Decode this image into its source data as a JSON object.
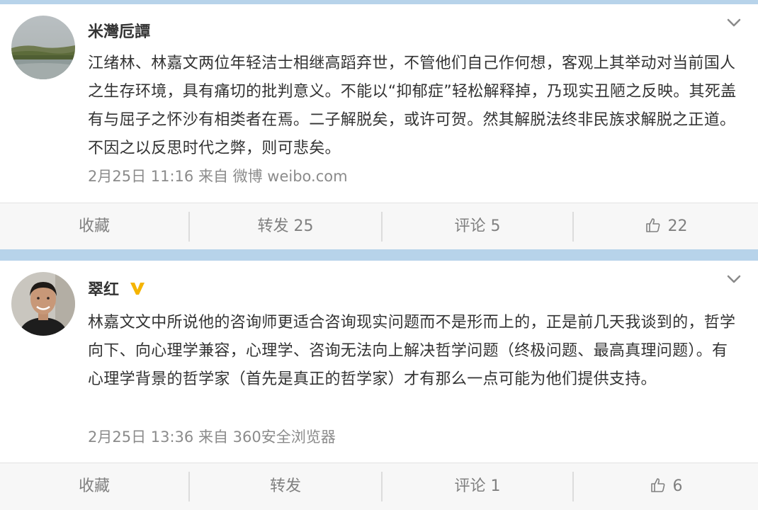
{
  "posts": [
    {
      "username": "米灣卮譚",
      "content": "江绪林、林嘉文两位年轻洁士相继高蹈弃世，不管他们自己作何想，客观上其举动对当前国人之生存环境，具有痛切的批判意义。不能以“抑郁症”轻松解释掉，乃现实丑陋之反映。其死盖有与屈子之怀沙有相类者在焉。二子解脱矣，或许可贺。然其解脱法终非民族求解脱之正道。不因之以反思时代之弊，则可悲矣。",
      "meta": "2月25日 11:16 来自 微博 weibo.com",
      "actions": {
        "favorite": "收藏",
        "repost": "转发 25",
        "comment": "评论 5",
        "like": "22"
      }
    },
    {
      "username": "翠红",
      "content": "林嘉文文中所说他的咨询师更适合咨询现实问题而不是形而上的，正是前几天我谈到的，哲学向下、向心理学兼容，心理学、咨询无法向上解决哲学问题（终极问题、最高真理问题）。有心理学背景的哲学家（首先是真正的哲学家）才有那么一点可能为他们提供支持。",
      "meta": "2月25日 13:36 来自 360安全浏览器",
      "actions": {
        "favorite": "收藏",
        "repost": "转发",
        "comment": "评论 1",
        "like": "6"
      }
    }
  ],
  "icons": {
    "menu": "chevron-down-icon",
    "like": "thumbs-up-icon",
    "verified": "vip-v-badge-icon"
  },
  "colors": {
    "separator": "#b7d3ea",
    "text": "#333333",
    "meta": "#8b8b8b",
    "action_text": "#808080",
    "badge": "#f5b400"
  }
}
